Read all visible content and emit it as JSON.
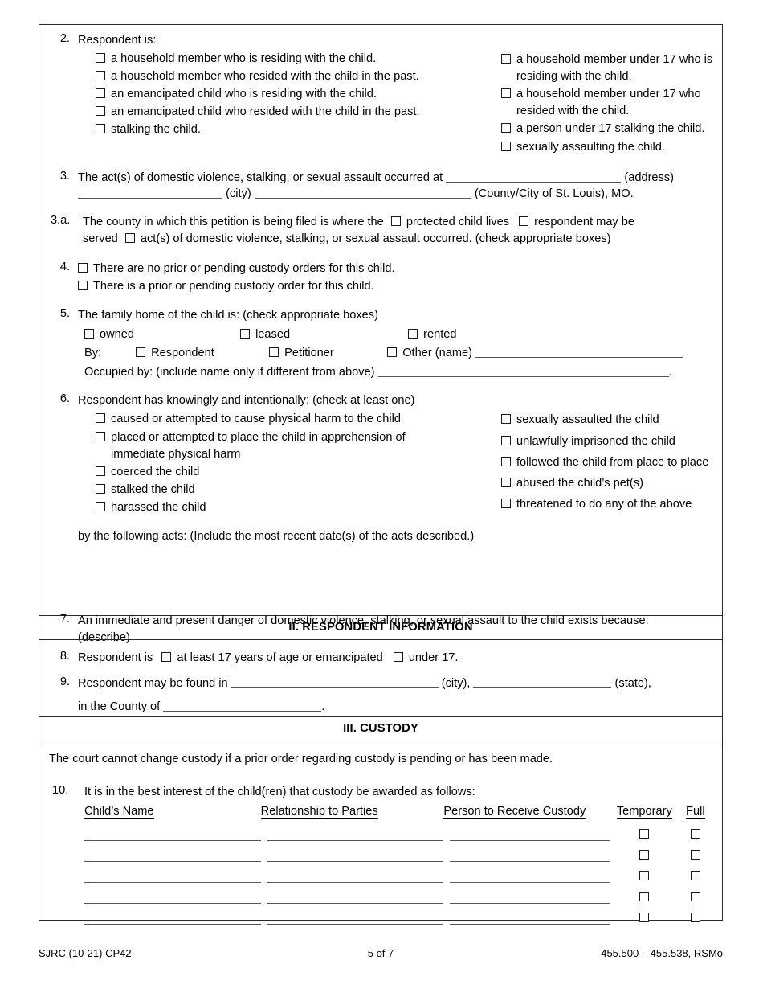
{
  "form": {
    "footer_left": "SJRC (10-21) CP42",
    "footer_center": "5  of  7",
    "footer_right": "455.500 – 455.538, RSMo"
  },
  "item2": {
    "number": "2.",
    "prompt": "Respondent is:",
    "left_options": [
      "a household member who is residing with the child.",
      "a household member who resided with the child in the past.",
      "an emancipated child who is residing with the child.",
      "an emancipated child who resided with the child in the past.",
      "stalking the child."
    ],
    "right_options": [
      "a household member under 17 who is residing with the child.",
      "a household member under 17 who resided with the child.",
      "a person under 17 stalking the child.",
      "sexually assaulting the child."
    ]
  },
  "item3": {
    "number": "3.",
    "text_before": "The act(s) of domestic violence, stalking, or sexual assault occurred at",
    "label_address": "(address)",
    "label_city": "(city)",
    "label_county": "(County/City of St. Louis), MO."
  },
  "item3a": {
    "number": "3.a.",
    "text_before": "The county in which this petition is being filed is where the",
    "option1": "protected child lives",
    "option2": "respondent may be",
    "text_served": "served",
    "option3": "act(s) of domestic violence, stalking, or sexual assault occurred. (check appropriate boxes)"
  },
  "item4": {
    "number": "4.",
    "options": [
      "There are no prior or pending custody orders for this child.",
      "There is a prior or pending custody order for this child."
    ]
  },
  "item5": {
    "number": "5.",
    "prompt": "The family home of the child is:  (check appropriate boxes)",
    "tenure": [
      "owned",
      "leased",
      "rented"
    ],
    "by_label": "By:",
    "by_options": [
      "Respondent",
      "Petitioner",
      "Other (name)"
    ],
    "occupied_label": "Occupied by: (include name only if different from above)",
    "occupied_period": "."
  },
  "item6": {
    "number": "6.",
    "prompt": "Respondent has knowingly and intentionally: (check at least one)",
    "left_options": [
      "caused or attempted to cause physical harm to the child",
      "placed or attempted to place the child in apprehension of immediate physical harm",
      "coerced the child",
      "stalked the child",
      "harassed the child"
    ],
    "right_options": [
      "sexually assaulted the child",
      "unlawfully imprisoned the child",
      "followed the child from place to place",
      "abused the child’s pet(s)",
      "threatened to do any of the above"
    ],
    "closing": "by the following acts: (Include the most recent date(s) of the acts described.)"
  },
  "item7": {
    "number": "7.",
    "text": "An immediate and present danger of domestic violence, stalking, or sexual assault to the child exists because: (describe)"
  },
  "section2": {
    "heading": "II. RESPONDENT INFORMATION"
  },
  "item8": {
    "number": "8.",
    "text_before": "Respondent is",
    "option1": "at least 17 years of age or emancipated",
    "option2": "under 17."
  },
  "item9": {
    "number": "9.",
    "text_before": "Respondent may be found in",
    "label_city": "(city),",
    "label_state": "(state),",
    "text_county": "in the County of",
    "county_period": "."
  },
  "section3": {
    "heading": "III. CUSTODY",
    "notice": "The court cannot change custody if a prior order regarding custody is pending or has been made."
  },
  "item10": {
    "number": "10.",
    "prompt": "It is in the best interest of the child(ren) that custody be awarded as follows:",
    "columns": [
      "Child’s Name",
      "Relationship to Parties",
      "Person to Receive Custody",
      "Temporary",
      "Full"
    ],
    "rows": [
      {
        "name": "",
        "relationship": "",
        "person": "",
        "temporary": false,
        "full": false
      },
      {
        "name": "",
        "relationship": "",
        "person": "",
        "temporary": false,
        "full": false
      },
      {
        "name": "",
        "relationship": "",
        "person": "",
        "temporary": false,
        "full": false
      },
      {
        "name": "",
        "relationship": "",
        "person": "",
        "temporary": false,
        "full": false
      },
      {
        "name": "",
        "relationship": "",
        "person": "",
        "temporary": false,
        "full": false
      }
    ]
  }
}
